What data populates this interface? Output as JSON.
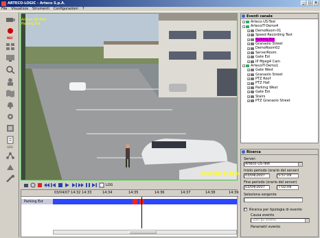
{
  "window": {
    "title": "ARTECO-LOGIC - Arteco S.p.A."
  },
  "menu": [
    "File",
    "Visualizza",
    "Strumenti",
    "Configurazioni",
    "?"
  ],
  "left_toolbar": {
    "rec_label": "REC",
    "log_label": "LOG"
  },
  "video": {
    "camera_label_line1": "Arteco-US-Test",
    "camera_label_line2": "Parking Est",
    "timestamp": "03/04/2007 14:35:51"
  },
  "controls": {
    "log_label": "LOG"
  },
  "timeline": {
    "date_label": "03/04/07 14:32 14:33",
    "ticks": [
      "14:34",
      "14:35",
      "14:36",
      "14:37",
      "14:38",
      "14:39"
    ],
    "row_label": "Parking Est"
  },
  "events_panel": {
    "title": "Eventi canale",
    "tree": [
      {
        "label": "Arteco-US-Test",
        "level": 0,
        "exp": "-"
      },
      {
        "label": "ArtecoIT-Demo4",
        "level": 0,
        "exp": "-"
      },
      {
        "label": "DemoRoom-01",
        "level": 1,
        "exp": "+"
      },
      {
        "label": "Speed Recording Test",
        "level": 1,
        "exp": "+"
      },
      {
        "label": "Parking Est",
        "level": 1,
        "exp": "+",
        "selected": true
      },
      {
        "label": "Granaolo Street",
        "level": 1,
        "exp": "+"
      },
      {
        "label": "DemoRoom02",
        "level": 1,
        "exp": "+"
      },
      {
        "label": "ServerRoom",
        "level": 1,
        "exp": "+"
      },
      {
        "label": "Gate Est",
        "level": 1,
        "exp": "+"
      },
      {
        "label": "IP Mpeg4 Cam",
        "level": 1,
        "exp": "+"
      },
      {
        "label": "ArtecoIT-Demo1",
        "level": 0,
        "exp": "-"
      },
      {
        "label": "Gate West",
        "level": 1,
        "exp": "+"
      },
      {
        "label": "Granaolo Street",
        "level": 1,
        "exp": "+"
      },
      {
        "label": "PTZ Roof",
        "level": 1,
        "exp": "+"
      },
      {
        "label": "PTZ Hall",
        "level": 1,
        "exp": "+"
      },
      {
        "label": "Parking West",
        "level": 1,
        "exp": "+"
      },
      {
        "label": "Gate Est",
        "level": 1,
        "exp": "+"
      },
      {
        "label": "Stairs",
        "level": 1,
        "exp": "+"
      },
      {
        "label": "PTZ Granaolo Street",
        "level": 1,
        "exp": "+"
      }
    ]
  },
  "search_panel": {
    "title": "Ricerca",
    "server_label": "Server:",
    "server_value": "Arteco-US-Test",
    "start_label": "Inizio periodo (orario del server)",
    "start_date": "03/04/2007",
    "start_time": "5:57:09",
    "end_label": "Fine periodo (orario del server)",
    "end_date": "03/04/2007",
    "end_time": "7:02:09",
    "current_label": "Seleziona sorgente",
    "event_type_label": "Ricerca per tipologia di evento",
    "cause_label": "Causa evento",
    "cause_value": "Tutti gli eventi",
    "param_label": "Parametri evento"
  }
}
